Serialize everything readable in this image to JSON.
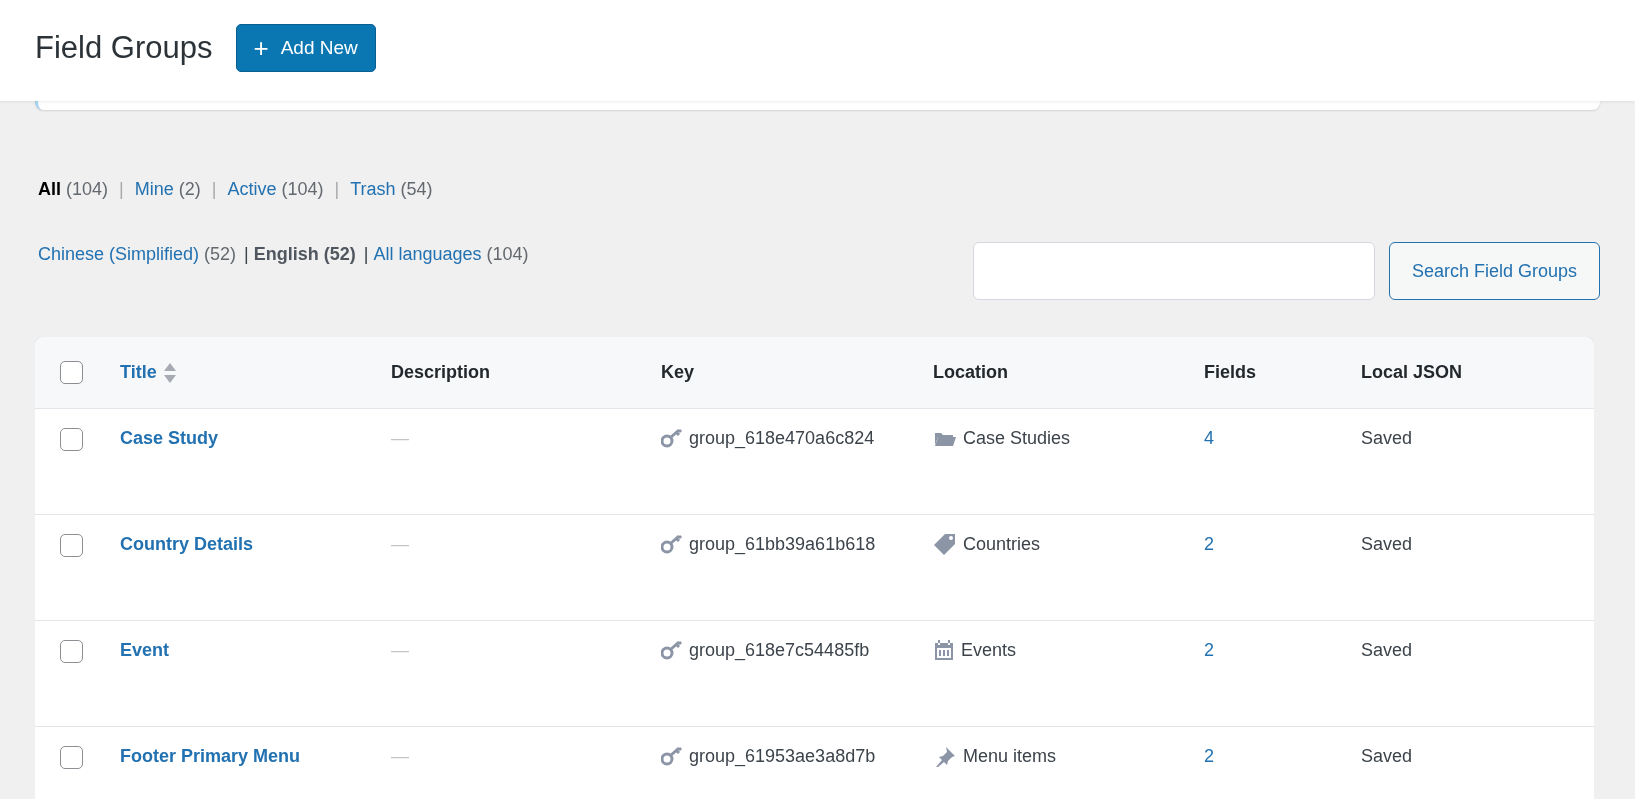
{
  "header": {
    "title": "Field Groups",
    "add_button": {
      "icon": "+",
      "label": "Add New"
    }
  },
  "status_filters": [
    {
      "label": "All",
      "count": "(104)",
      "selected": true
    },
    {
      "separator_before": "|",
      "label": "Mine",
      "count": "(2)",
      "selected": false
    },
    {
      "separator_before": "|",
      "label": "Active",
      "count": "(104)",
      "selected": false
    },
    {
      "separator_before": "|",
      "label": "Trash",
      "count": "(54)",
      "selected": false
    }
  ],
  "language_filters": [
    {
      "label": "Chinese (Simplified)",
      "count": "(52)",
      "selected": false
    },
    {
      "separator_before": "|",
      "label": "English",
      "count": "(52)",
      "selected": true
    },
    {
      "separator_before": "|",
      "label": "All languages",
      "count": "(104)",
      "selected": false
    }
  ],
  "search": {
    "button": "Search Field Groups"
  },
  "table": {
    "select_all": {
      "checked": false
    },
    "columns": [
      "Title",
      "Description",
      "Key",
      "Location",
      "Fields",
      "Local JSON"
    ],
    "rows": [
      {
        "checked": false,
        "title": "Case Study",
        "description": "—",
        "key": "group_618e470a6c824",
        "location": {
          "kind": "folder",
          "label": "Case Studies"
        },
        "fields": "4",
        "local_json": "Saved"
      },
      {
        "checked": false,
        "title": "Country Details",
        "description": "—",
        "key": "group_61bb39a61b618",
        "location": {
          "kind": "tag",
          "label": "Countries"
        },
        "fields": "2",
        "local_json": "Saved"
      },
      {
        "checked": false,
        "title": "Event",
        "description": "—",
        "key": "group_618e7c54485fb",
        "location": {
          "kind": "calendar",
          "label": "Events"
        },
        "fields": "2",
        "local_json": "Saved"
      },
      {
        "checked": false,
        "title": "Footer Primary Menu",
        "description": "—",
        "key": "group_61953ae3a8d7b",
        "location": {
          "kind": "pin",
          "label": "Menu items"
        },
        "fields": "2",
        "local_json": "Saved"
      }
    ]
  }
}
